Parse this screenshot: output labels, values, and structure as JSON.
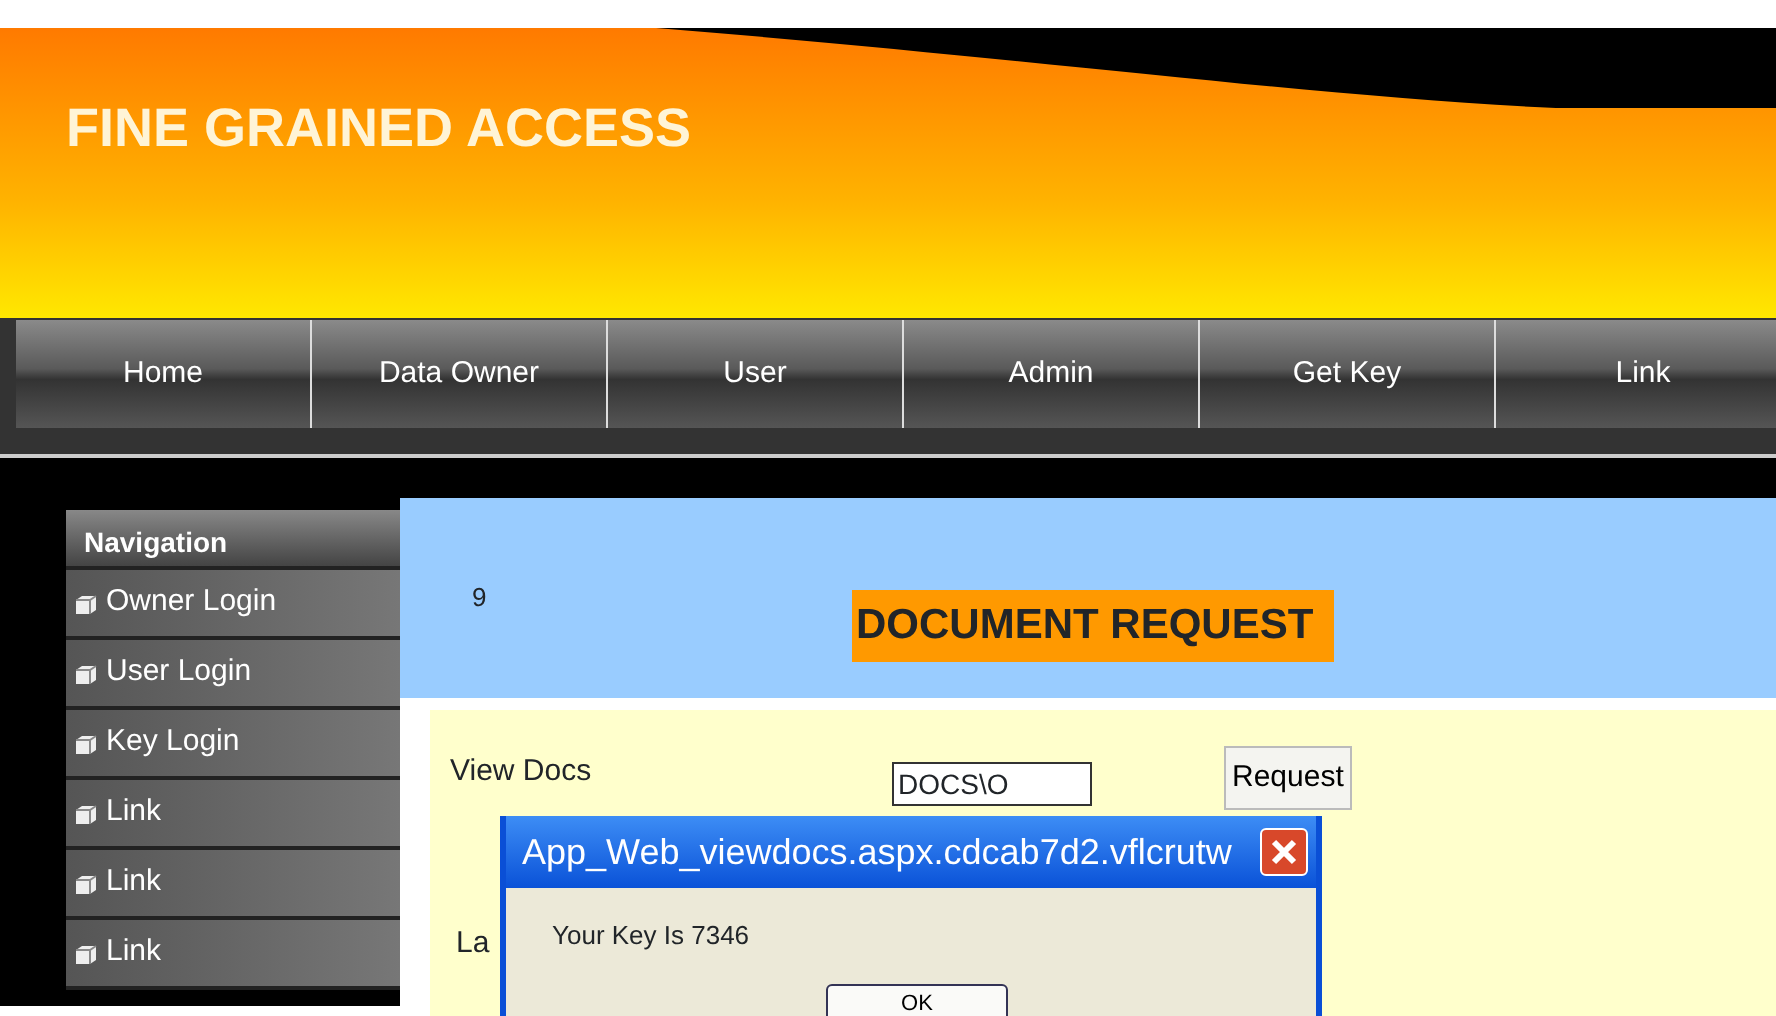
{
  "header": {
    "title": "FINE GRAINED ACCESS"
  },
  "menu": [
    {
      "label": "Home"
    },
    {
      "label": "Data Owner"
    },
    {
      "label": "User"
    },
    {
      "label": "Admin"
    },
    {
      "label": "Get Key"
    },
    {
      "label": "Link"
    }
  ],
  "sidebar": {
    "title": "Navigation",
    "items": [
      {
        "label": "Owner Login"
      },
      {
        "label": "User Login"
      },
      {
        "label": "Key Login"
      },
      {
        "label": "Link"
      },
      {
        "label": "Link"
      },
      {
        "label": "Link"
      }
    ]
  },
  "content": {
    "counter": "9",
    "heading": "DOCUMENT REQUEST",
    "view_docs_label": "View Docs",
    "docs_select": {
      "value": "DOCS\\O"
    },
    "request_button": "Request",
    "label_2": "La"
  },
  "dialog": {
    "title": "App_Web_viewdocs.aspx.cdcab7d2.vflcrutw",
    "message": "Your Key Is 7346",
    "ok_button": "OK"
  }
}
